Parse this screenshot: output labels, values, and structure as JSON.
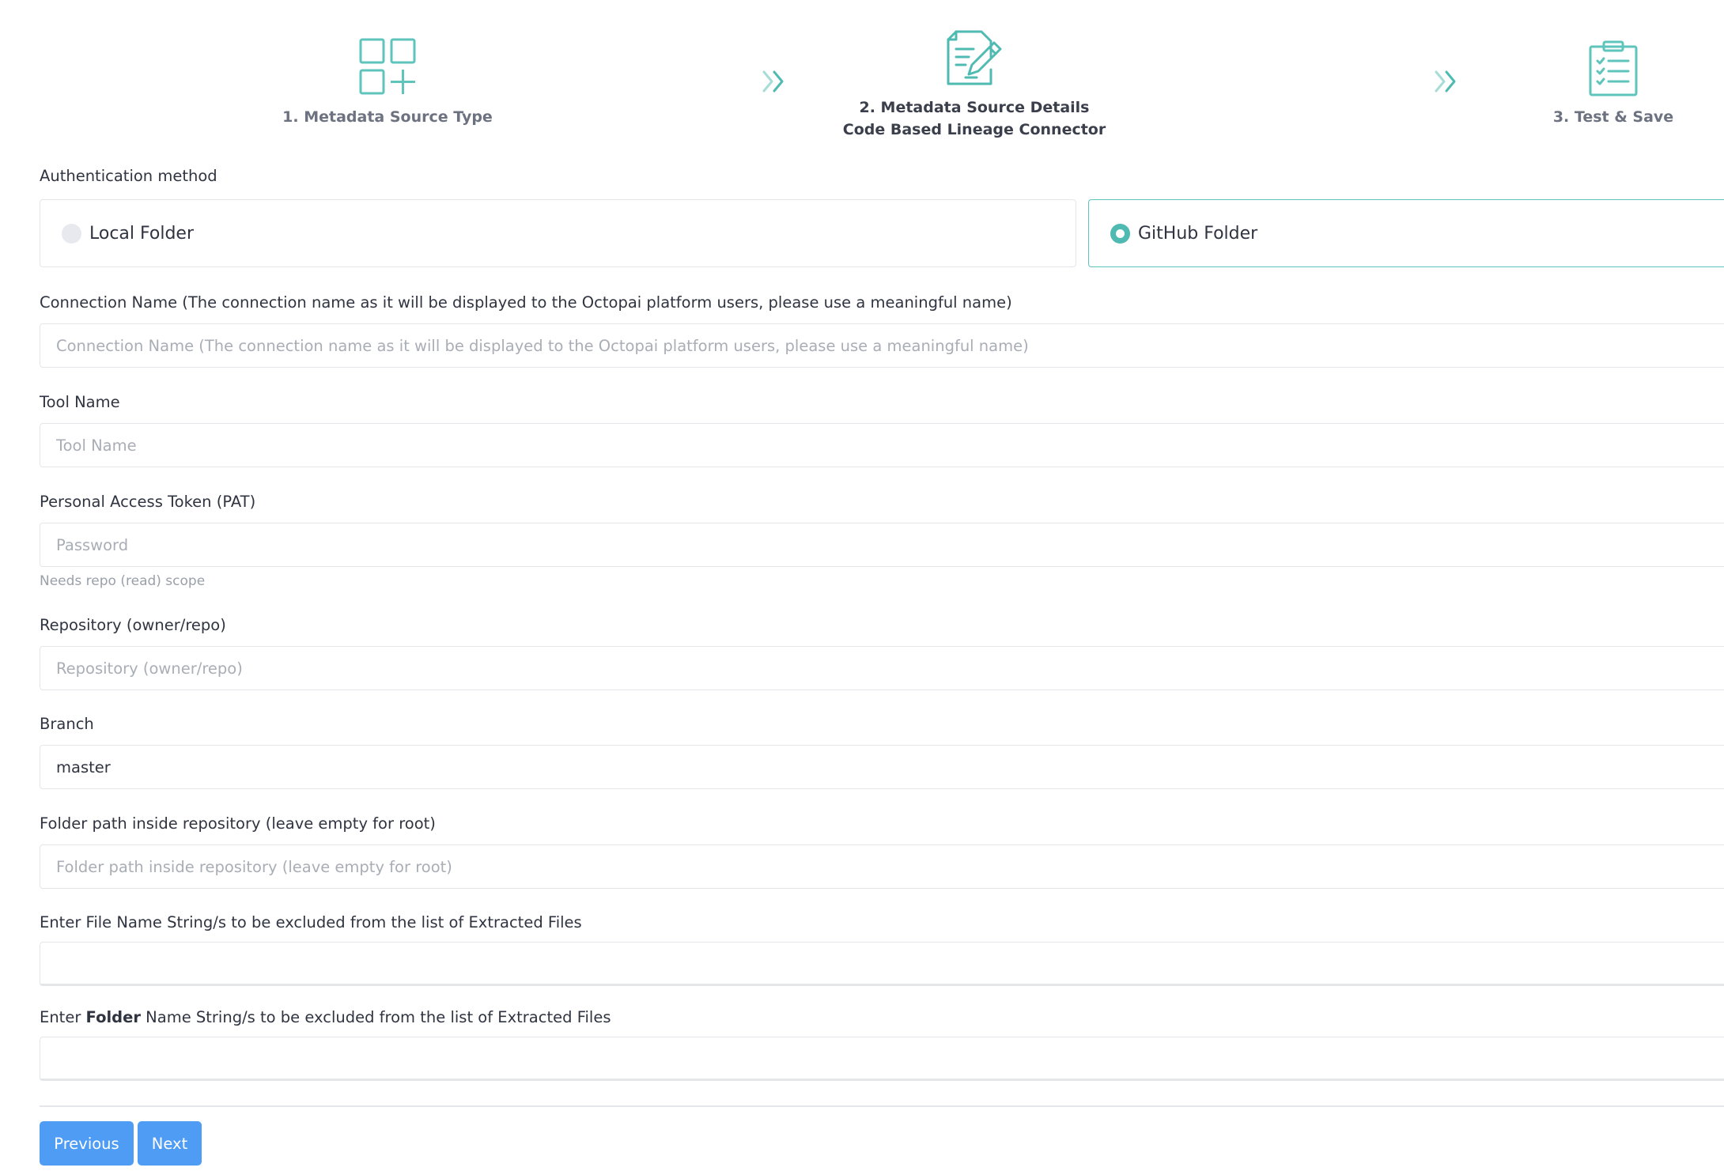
{
  "colors": {
    "accent": "#4fbab2",
    "primary_button": "#4f9cf5",
    "border": "#e4e6ea",
    "placeholder": "#a9adb6"
  },
  "stepper": {
    "steps": [
      {
        "label": "1. Metadata Source Type",
        "icon": "grid-plus-icon"
      },
      {
        "label": "2. Metadata Source Details",
        "sublabel": "Code Based Lineage Connector",
        "icon": "edit-document-icon"
      },
      {
        "label": "3. Test & Save",
        "icon": "clipboard-checklist-icon"
      }
    ],
    "separator_icon": "double-chevron-right-icon"
  },
  "form": {
    "auth": {
      "label": "Authentication method",
      "options": [
        {
          "label": "Local Folder",
          "selected": false
        },
        {
          "label": "GitHub Folder",
          "selected": true
        }
      ]
    },
    "connection_name": {
      "label": "Connection Name (The connection name as it will be displayed to the Octopai platform users, please use a meaningful name)",
      "placeholder": "Connection Name (The connection name as it will be displayed to the Octopai platform users, please use a meaningful name)",
      "value": ""
    },
    "tool_name": {
      "label": "Tool Name",
      "placeholder": "Tool Name",
      "value": ""
    },
    "pat": {
      "label": "Personal Access Token (PAT)",
      "placeholder": "Password",
      "value": "",
      "help": "Needs repo (read) scope"
    },
    "repository": {
      "label": "Repository (owner/repo)",
      "placeholder": "Repository (owner/repo)",
      "value": ""
    },
    "branch": {
      "label": "Branch",
      "placeholder": "",
      "value": "master"
    },
    "folder_path": {
      "label": "Folder path inside repository (leave empty for root)",
      "placeholder": "Folder path inside repository (leave empty for root)",
      "value": ""
    },
    "exclude_files": {
      "label": "Enter File Name String/s to be excluded from the list of Extracted Files"
    },
    "exclude_folders": {
      "label_prefix": "Enter ",
      "label_bold": "Folder",
      "label_suffix": " Name String/s to be excluded from the list of Extracted Files"
    }
  },
  "buttons": {
    "previous": "Previous",
    "next": "Next"
  }
}
